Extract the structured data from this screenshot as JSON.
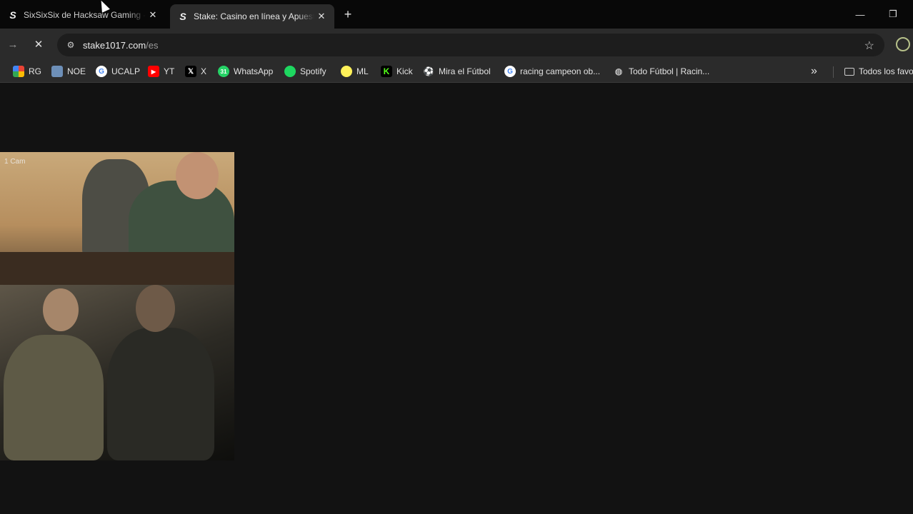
{
  "tabs": [
    {
      "title": "SixSixSix de Hacksaw Gaming -",
      "favicon": "S",
      "active": false
    },
    {
      "title": "Stake: Casino en línea y Apuestas",
      "favicon": "S",
      "active": true
    }
  ],
  "toolbar": {
    "url_host": "stake1017.com",
    "url_path": "/es"
  },
  "bookmarks": [
    {
      "label": "RG",
      "icon": "grid-color-icon",
      "color": "#4285f4"
    },
    {
      "label": "NOE",
      "icon": "image-icon",
      "color": "#6d8fb8"
    },
    {
      "label": "UCALP",
      "icon": "google-icon",
      "color": "#ffffff"
    },
    {
      "label": "YT",
      "icon": "youtube-icon",
      "color": "#ff0000"
    },
    {
      "label": "X",
      "icon": "x-icon",
      "color": "#000000"
    },
    {
      "label": "WhatsApp",
      "icon": "whatsapp-icon",
      "color": "#25d366"
    },
    {
      "label": "Spotify",
      "icon": "spotify-icon",
      "color": "#1ed760"
    },
    {
      "label": "ML",
      "icon": "mercadolibre-icon",
      "color": "#fff159"
    },
    {
      "label": "Kick",
      "icon": "kick-icon",
      "color": "#53fc18"
    },
    {
      "label": "Mira el Fútbol",
      "icon": "soccer-ball-icon",
      "color": "#dddddd"
    },
    {
      "label": "racing campeon ob...",
      "icon": "google-icon",
      "color": "#ffffff"
    },
    {
      "label": "Todo Fútbol | Racin...",
      "icon": "globe-icon",
      "color": "#9bb"
    }
  ],
  "bookmarks_overflow": "»",
  "all_bookmarks": "Todos los favo",
  "webcam": {
    "label": "1 Cam"
  }
}
